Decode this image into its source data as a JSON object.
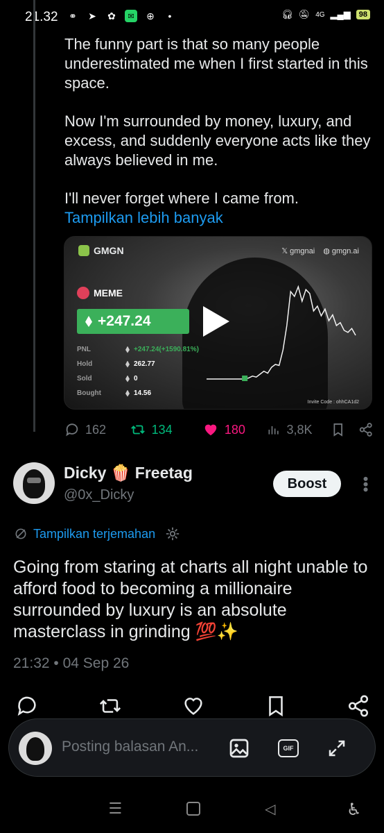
{
  "status_bar": {
    "time": "21.32",
    "network": "4G",
    "battery": "98"
  },
  "ghost_text": "$MEME",
  "post": {
    "paragraphs": [
      "The funny part is that so many people underestimated me when I first started in this space.",
      "Now I'm surrounded by money, luxury, and excess, and suddenly everyone acts like they always believed in me.",
      "I'll never forget where I came from."
    ],
    "show_more": "Tampilkan lebih banyak"
  },
  "video_card": {
    "brand": "GMGN",
    "tag_x": "gmgnai",
    "tag_web": "gmgn.ai",
    "token": "MEME",
    "pnl_big": "+247.24",
    "stats": [
      {
        "label": "PNL",
        "value": "+247.24(+1590.81%)"
      },
      {
        "label": "Hold",
        "value": "262.77"
      },
      {
        "label": "Sold",
        "value": "0"
      },
      {
        "label": "Bought",
        "value": "14.56"
      }
    ],
    "invite": "Invite Code : ohhCA1d2"
  },
  "engagement": {
    "replies": "162",
    "reposts": "134",
    "likes": "180",
    "views": "3,8K"
  },
  "reply": {
    "name": "Dicky 🍿 Freetag",
    "handle": "@0x_Dicky",
    "boost_label": "Boost",
    "translate_label": "Tampilkan terjemahan",
    "text": "Going from staring at charts all night unable to afford food to becoming a millionaire surrounded by luxury is an absolute masterclass in grinding 💯✨",
    "timestamp": "21:32 • 04 Sep 26"
  },
  "composer": {
    "placeholder": "Posting balasan An...",
    "gif_label": "GIF"
  },
  "colors": {
    "accent": "#1d9bf0",
    "repost": "#00ba7c",
    "like": "#f91880",
    "muted": "#71767b"
  },
  "chart_data": {
    "type": "line",
    "title": "",
    "xlabel": "",
    "ylabel": "",
    "x": [
      0,
      1,
      2,
      3,
      4,
      5,
      6,
      7,
      8,
      9,
      10,
      11,
      12,
      13,
      14,
      15,
      16,
      17,
      18,
      19,
      20,
      21,
      22,
      23,
      24,
      25,
      26,
      27,
      28,
      29,
      30,
      31,
      32,
      33,
      34,
      35,
      36,
      37,
      38,
      39
    ],
    "values": [
      0,
      0,
      0,
      0,
      0,
      0,
      0,
      0,
      0,
      0,
      0,
      1,
      3,
      2,
      5,
      8,
      6,
      12,
      15,
      14,
      30,
      55,
      90,
      85,
      95,
      80,
      92,
      88,
      70,
      75,
      65,
      72,
      60,
      66,
      55,
      58,
      50,
      48,
      52,
      45
    ],
    "ylim": [
      0,
      100
    ],
    "grid": false
  }
}
